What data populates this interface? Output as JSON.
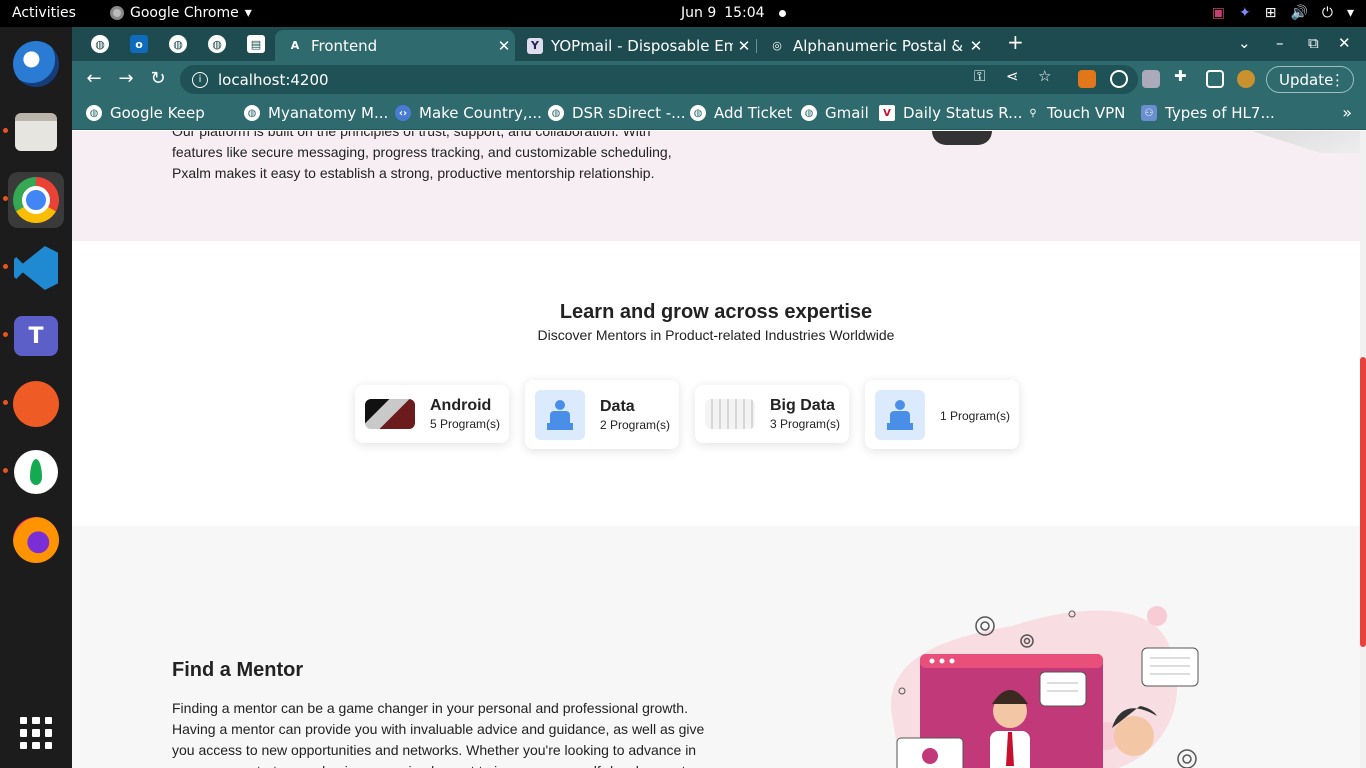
{
  "system": {
    "activities": "Activities",
    "app_name": "Google Chrome",
    "date": "Jun 9",
    "time": "15:04"
  },
  "browser": {
    "tabs": [
      {
        "title": "Frontend",
        "favicon": "A",
        "active": true
      },
      {
        "title": "YOPmail - Disposable Ema",
        "favicon": "Y",
        "active": false
      },
      {
        "title": "Alphanumeric Postal & Ac",
        "favicon": "◎",
        "active": false
      }
    ],
    "url": "localhost:4200",
    "update_label": "Update",
    "bookmarks": [
      {
        "label": "Google Keep"
      },
      {
        "label": "Myanatomy M..."
      },
      {
        "label": "Make Country,..."
      },
      {
        "label": "DSR sDirect -..."
      },
      {
        "label": "Add Ticket"
      },
      {
        "label": "Gmail"
      },
      {
        "label": "Daily Status R..."
      },
      {
        "label": "Touch VPN"
      },
      {
        "label": "Types of HL7..."
      }
    ],
    "colors": {
      "tabbar": "#1d4b4f",
      "toolbar": "#2e6a6e"
    }
  },
  "page": {
    "intro_text": "Our platform is built on the principles of trust, support, and collaboration. With features like secure messaging, progress tracking, and customizable scheduling, Pxalm makes it easy to establish a strong, productive mentorship relationship.",
    "expertise": {
      "title": "Learn and grow across expertise",
      "subtitle": "Discover Mentors in Product-related Industries Worldwide",
      "cards": [
        {
          "name": "Android",
          "count": "5 Program(s)",
          "image": "car-photo"
        },
        {
          "name": "Data",
          "count": "2 Program(s)",
          "image": "person-icon"
        },
        {
          "name": "Big Data",
          "count": "3 Program(s)",
          "image": "table-screenshot"
        },
        {
          "name": "",
          "count": "1 Program(s)",
          "image": "person-icon"
        }
      ]
    },
    "find_mentor": {
      "title": "Find a Mentor",
      "text": "Finding a mentor can be a game changer in your personal and professional growth. Having a mentor can provide you with invaluable advice and guidance, as well as give you access to new opportunities and networks. Whether you're looking to advance in your career, start a new business, or simply want to improve your self-development"
    }
  }
}
